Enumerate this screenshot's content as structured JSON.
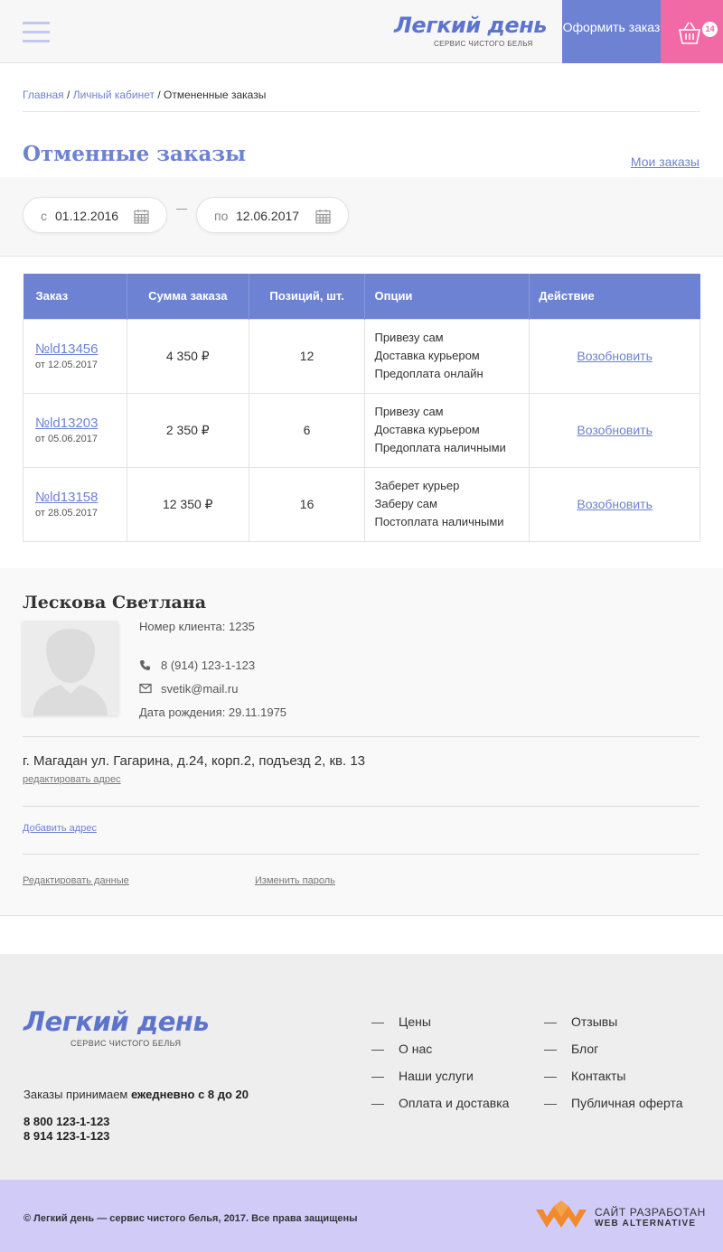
{
  "header": {
    "logo_title": "Легкий день",
    "logo_subtitle": "сервис чистого белья",
    "order_button": "Оформить заказ",
    "cart_count": "14"
  },
  "breadcrumb": {
    "home": "Главная",
    "cabinet": "Личный кабинет",
    "current": "Отмененные заказы",
    "separator": "/"
  },
  "page": {
    "title": "Отменные заказы",
    "my_orders_link": "Мои заказы"
  },
  "filter": {
    "from_prefix": "с",
    "from_value": "01.12.2016",
    "to_prefix": "по",
    "to_value": "12.06.2017"
  },
  "table": {
    "headers": [
      "Заказ",
      "Сумма заказа",
      "Позиций, шт.",
      "Опции",
      "Действие"
    ],
    "rows": [
      {
        "order": "№ld13456",
        "date": "от 12.05.2017",
        "sum": "4 350 ₽",
        "count": "12",
        "options": [
          "Привезу сам",
          "Доставка курьером",
          "Предоплата онлайн"
        ],
        "action": "Возобновить"
      },
      {
        "order": "№ld13203",
        "date": "от 05.06.2017",
        "sum": "2 350 ₽",
        "count": "6",
        "options": [
          "Привезу сам",
          "Доставка курьером",
          "Предоплата наличными"
        ],
        "action": "Возобновить"
      },
      {
        "order": "№ld13158",
        "date": "от 28.05.2017",
        "sum": "12 350 ₽",
        "count": "16",
        "options": [
          "Заберет курьер",
          "Заберу сам",
          "Постоплата наличными"
        ],
        "action": "Возобновить"
      }
    ]
  },
  "profile": {
    "name": "Лескова Светлана",
    "client_number": "Номер клиента: 1235",
    "phone": "8 (914) 123-1-123",
    "email": "svetik@mail.ru",
    "birthday": "Дата рождения: 29.11.1975",
    "address": "г. Магадан ул. Гагарина, д.24, корп.2, подъезд 2, кв. 13",
    "edit_address": "редактировать адрес",
    "add_address": "Добавить адрес",
    "edit_data": "Редактировать данные",
    "change_password": "Изменить пароль"
  },
  "footer": {
    "logo_title": "Легкий день",
    "logo_subtitle": "сервис чистого белья",
    "hours_text": "Заказы  принимаем",
    "hours_bold": "ежедневно с 8 до 20",
    "phone1": "8 800 123-1-123",
    "phone2": "8 914  123-1-123",
    "menu_col1": [
      "Цены",
      "О нас",
      "Наши услуги",
      "Оплата и доставка"
    ],
    "menu_col2": [
      "Отзывы",
      "Блог",
      "Контакты",
      "Публичная оферта"
    ],
    "copyright": "© Легкий день — сервис чистого белья, 2017. Все права защищены",
    "dev_line1": "САЙТ РАЗРАБОТАН",
    "dev_line2": "WEB ALTERNATIVE"
  },
  "colors": {
    "accent": "#6d82d3",
    "cart": "#f16aa6",
    "bottom_bar": "#d1cbf8"
  }
}
